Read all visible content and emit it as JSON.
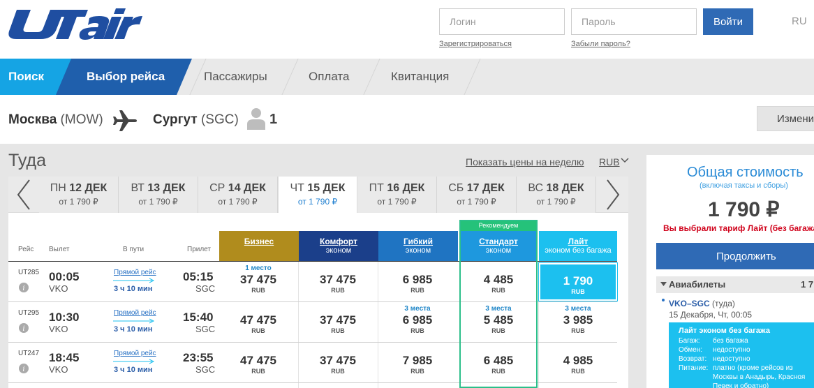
{
  "header": {
    "login_placeholder": "Логин",
    "password_placeholder": "Пароль",
    "login_button": "Войти",
    "lang": "RU",
    "register_link": "Зарегистрироваться",
    "forgot_link": "Забыли пароль?"
  },
  "steps": [
    "Поиск",
    "Выбор рейса",
    "Пассажиры",
    "Оплата",
    "Квитанция"
  ],
  "route": {
    "from_city": "Москва",
    "from_code": "(MOW)",
    "to_city": "Сургут",
    "to_code": "(SGC)",
    "passengers": "1",
    "change_button": "Измени"
  },
  "direction_title": "Туда",
  "week_prices_link": "Показать цены на неделю",
  "currency": "RUB",
  "dates": [
    {
      "dow": "ПН",
      "day": "12 ДЕК",
      "price": "от 1 790 ₽"
    },
    {
      "dow": "ВТ",
      "day": "13 ДЕК",
      "price": "от 1 790 ₽"
    },
    {
      "dow": "СР",
      "day": "14 ДЕК",
      "price": "от 1 790 ₽"
    },
    {
      "dow": "ЧТ",
      "day": "15 ДЕК",
      "price": "от 1 790 ₽"
    },
    {
      "dow": "ПТ",
      "day": "16 ДЕК",
      "price": "от 1 790 ₽"
    },
    {
      "dow": "СБ",
      "day": "17 ДЕК",
      "price": "от 1 790 ₽"
    },
    {
      "dow": "ВС",
      "day": "18 ДЕК",
      "price": "от 1 790 ₽"
    }
  ],
  "columns": {
    "flight": "Рейс",
    "departure": "Вылет",
    "duration": "В пути",
    "arrival": "Прилет"
  },
  "recommended_label": "Рекомендуем",
  "tariffs": [
    {
      "name": "Бизнес",
      "sub": "",
      "color": "#b08c1d"
    },
    {
      "name": "Комфорт",
      "sub": "эконом",
      "color": "#1b3f8a"
    },
    {
      "name": "Гибкий",
      "sub": "эконом",
      "color": "#1f74c2"
    },
    {
      "name": "Стандарт",
      "sub": "эконом",
      "color": "#1e98de"
    },
    {
      "name": "Лайт",
      "sub": "эконом без багажа",
      "color": "#1cc0ef"
    }
  ],
  "flights": [
    {
      "code": "UT285",
      "dep_time": "00:05",
      "dep_ap": "VKO",
      "direct": "Прямой рейс",
      "duration": "3 ч 10 мин",
      "arr_time": "05:15",
      "arr_ap": "SGC",
      "prices": [
        {
          "seats": "1 место",
          "value": "37 475",
          "cur": "RUB"
        },
        {
          "seats": "",
          "value": "37 475",
          "cur": "RUB"
        },
        {
          "seats": "",
          "value": "6 985",
          "cur": "RUB"
        },
        {
          "seats": "",
          "value": "4 485",
          "cur": "RUB"
        },
        {
          "seats": "",
          "value": "1 790",
          "cur": "RUB"
        }
      ]
    },
    {
      "code": "UT295",
      "dep_time": "10:30",
      "dep_ap": "VKO",
      "direct": "Прямой рейс",
      "duration": "3 ч 10 мин",
      "arr_time": "15:40",
      "arr_ap": "SGC",
      "prices": [
        {
          "seats": "",
          "value": "47 475",
          "cur": "RUB"
        },
        {
          "seats": "",
          "value": "37 475",
          "cur": "RUB"
        },
        {
          "seats": "3 места",
          "value": "6 985",
          "cur": "RUB"
        },
        {
          "seats": "3 места",
          "value": "5 485",
          "cur": "RUB"
        },
        {
          "seats": "3 места",
          "value": "3 985",
          "cur": "RUB"
        }
      ]
    },
    {
      "code": "UT247",
      "dep_time": "18:45",
      "dep_ap": "VKO",
      "direct": "Прямой рейс",
      "duration": "3 ч 10 мин",
      "arr_time": "23:55",
      "arr_ap": "SGC",
      "prices": [
        {
          "seats": "",
          "value": "47 475",
          "cur": "RUB"
        },
        {
          "seats": "",
          "value": "37 475",
          "cur": "RUB"
        },
        {
          "seats": "",
          "value": "7 985",
          "cur": "RUB"
        },
        {
          "seats": "",
          "value": "6 485",
          "cur": "RUB"
        },
        {
          "seats": "",
          "value": "4 985",
          "cur": "RUB"
        }
      ]
    }
  ],
  "summary": {
    "title": "Общая стоимость",
    "subtitle": "(включая таксы и сборы)",
    "price": "1 790 ₽",
    "tariff_note": "Вы выбрали тариф Лайт (без багажа)",
    "continue_button": "Продолжить",
    "tickets_label": "Авиабилеты",
    "tickets_amount": "1 7",
    "leg_route": "VKO–SGC",
    "leg_direction": "(туда)",
    "leg_date": "15 Декабря, Чт, 00:05",
    "tariff_title": "Лайт эконом без багажа",
    "details": [
      {
        "k": "Багаж:",
        "v": "без багажа"
      },
      {
        "k": "Обмен:",
        "v": "недоступно"
      },
      {
        "k": "Возврат:",
        "v": "недоступно"
      },
      {
        "k": "Питание:",
        "v": "платно (кроме рейсов из"
      },
      {
        "k": "",
        "v": "Москвы в Анадырь, Красноя"
      },
      {
        "k": "",
        "v": "Певек и обратно)"
      }
    ]
  },
  "colors": {
    "brand_blue": "#1f5fac",
    "accent_cyan": "#1cc0ef",
    "recommend_green": "#25c27a",
    "alert_red": "#d0021b"
  }
}
